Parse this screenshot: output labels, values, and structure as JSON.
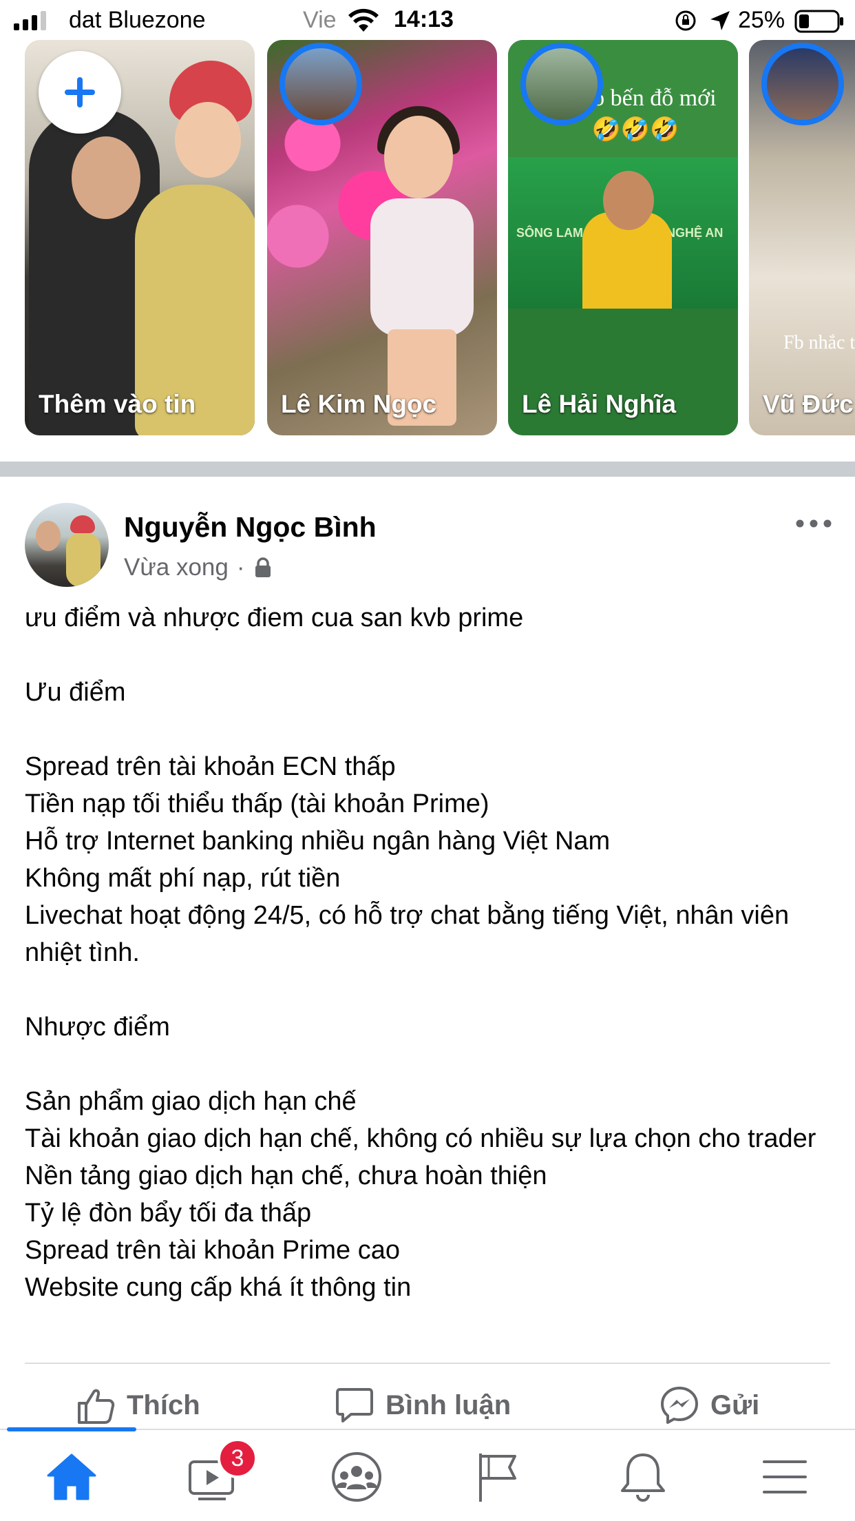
{
  "status_bar": {
    "carrier": "dat Bluezone",
    "carrier_secondary": "Vie",
    "time": "14:13",
    "battery": "25%"
  },
  "stories": [
    {
      "label": "Thêm vào tin",
      "type": "add",
      "icon": "plus-icon"
    },
    {
      "label": "Lê Kim Ngọc"
    },
    {
      "label": "Lê Hải Nghĩa",
      "caption": "đã có bến đỗ mới 🤣🤣🤣",
      "banner_left": "SÔNG LAM",
      "banner_right": "NGHỆ AN"
    },
    {
      "label": "Vũ Đức",
      "caption": "Fb nhắc trướ"
    }
  ],
  "post": {
    "author": "Nguyễn Ngọc Bình",
    "time": "Vừa xong",
    "separator": "·",
    "privacy_icon": "lock-icon",
    "body": "ưu điểm và nhược điem cua san kvb prime\n\nƯu điểm\n\nSpread trên tài khoản ECN thấp\nTiền nạp tối thiểu thấp (tài khoản Prime)\nHỗ trợ Internet banking nhiều ngân hàng Việt Nam\nKhông mất phí nạp, rút tiền\nLivechat hoạt động 24/5, có hỗ trợ chat bằng tiếng Việt, nhân viên nhiệt tình.\n\nNhược điểm\n\nSản phẩm giao dịch hạn chế\nTài khoản giao dịch hạn chế, không có nhiều sự lựa chọn cho trader\nNền tảng giao dịch hạn chế, chưa hoàn thiện\nTỷ lệ đòn bẩy tối đa thấp\nSpread trên tài khoản Prime cao\nWebsite cung cấp khá ít thông tin"
  },
  "actions": {
    "like": "Thích",
    "comment": "Bình luận",
    "send": "Gửi"
  },
  "tabbar": {
    "items": [
      "home-icon",
      "watch-icon",
      "groups-icon",
      "pages-icon",
      "notifications-icon",
      "menu-icon"
    ],
    "watch_badge": "3",
    "active": "home"
  },
  "colors": {
    "accent": "#1877f2",
    "badge": "#e41e3f",
    "secondary_text": "#65676b"
  }
}
